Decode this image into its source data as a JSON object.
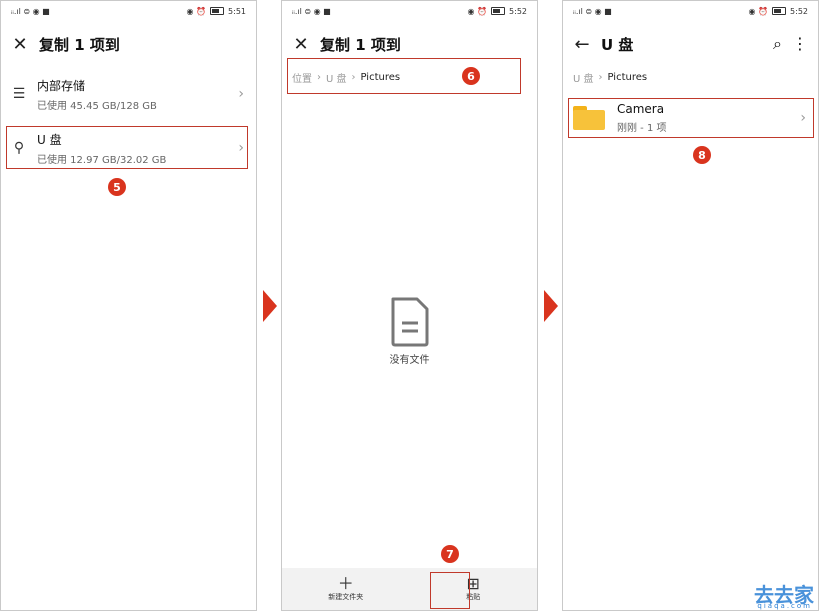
{
  "status": {
    "signal": "ᵢᵢ.ıl ⊜ ◉ ■",
    "time1": "5:51",
    "time2": "5:52",
    "time3": "5:52",
    "icons": "◉ ⏰"
  },
  "panel1": {
    "title": "复制 1 项到",
    "items": [
      {
        "title": "内部存储",
        "sub": "已使用 45.45 GB/128 GB"
      },
      {
        "title": "U 盘",
        "sub": "已使用 12.97 GB/32.02 GB"
      }
    ],
    "badge": "5"
  },
  "panel2": {
    "title": "复制 1 项到",
    "crumbs": [
      "位置",
      "U 盘",
      "Pictures"
    ],
    "badge_crumb": "6",
    "empty_text": "没有文件",
    "bottom": {
      "new_folder": "新建文件夹",
      "paste": "粘贴"
    },
    "badge_paste": "7"
  },
  "panel3": {
    "title": "U 盘",
    "crumbs": [
      "U 盘",
      "Pictures"
    ],
    "folder": {
      "name": "Camera",
      "sub": "刚刚 - 1 项"
    },
    "badge": "8"
  },
  "watermark": {
    "main": "去去家",
    "sub": "qiaqa.com"
  },
  "colors": {
    "accent_red": "#d9341e",
    "folder": "#f7c23a"
  }
}
